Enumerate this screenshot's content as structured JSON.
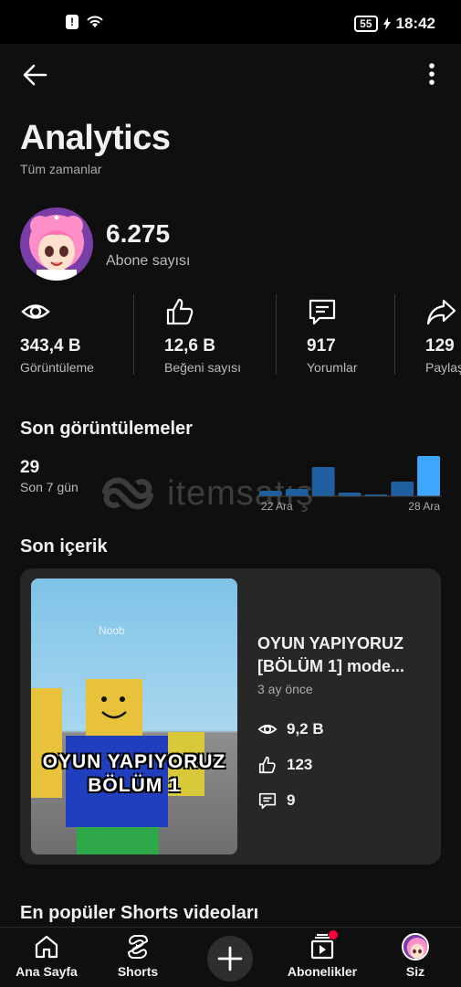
{
  "status_bar": {
    "time": "18:42",
    "battery": "55"
  },
  "header": {
    "title": "Analytics",
    "subtitle": "Tüm zamanlar"
  },
  "channel": {
    "subscriber_count": "6.275",
    "subscriber_label": "Abone sayısı"
  },
  "stats": [
    {
      "icon": "eye-icon",
      "value": "343,4 B",
      "label": "Görüntüleme"
    },
    {
      "icon": "thumbs-up-icon",
      "value": "12,6 B",
      "label": "Beğeni sayısı"
    },
    {
      "icon": "comment-icon",
      "value": "917",
      "label": "Yorumlar"
    },
    {
      "icon": "share-icon",
      "value": "129",
      "label": "Paylaş"
    }
  ],
  "recent_views": {
    "section_title": "Son görüntülemeler",
    "value": "29",
    "period_label": "Son 7 gün",
    "chart_data": {
      "type": "bar",
      "x_labels": [
        "22 Ara",
        "28 Ara"
      ],
      "values": [
        3,
        4,
        16,
        2,
        1,
        8,
        22
      ]
    }
  },
  "watermark": "itemsatış",
  "recent_content": {
    "section_title": "Son içerik",
    "thumbnail_text": "OYUN YAPIYORUZ BÖLÜM 1",
    "thumbnail_caption": "Noob",
    "title_line1": "OYUN YAPIYORUZ",
    "title_line2": "[BÖLÜM 1] mode...",
    "age": "3 ay önce",
    "views": "9,2 B",
    "likes": "123",
    "comments": "9"
  },
  "popular_shorts": {
    "section_title": "En popüler Shorts videoları"
  },
  "bottom_nav": {
    "home": "Ana Sayfa",
    "shorts": "Shorts",
    "subscriptions": "Abonelikler",
    "you": "Siz"
  },
  "colors": {
    "accent_bar": "#3ea6ff",
    "dim_bar": "#1f5fa0",
    "notification_dot": "#ff0033"
  }
}
